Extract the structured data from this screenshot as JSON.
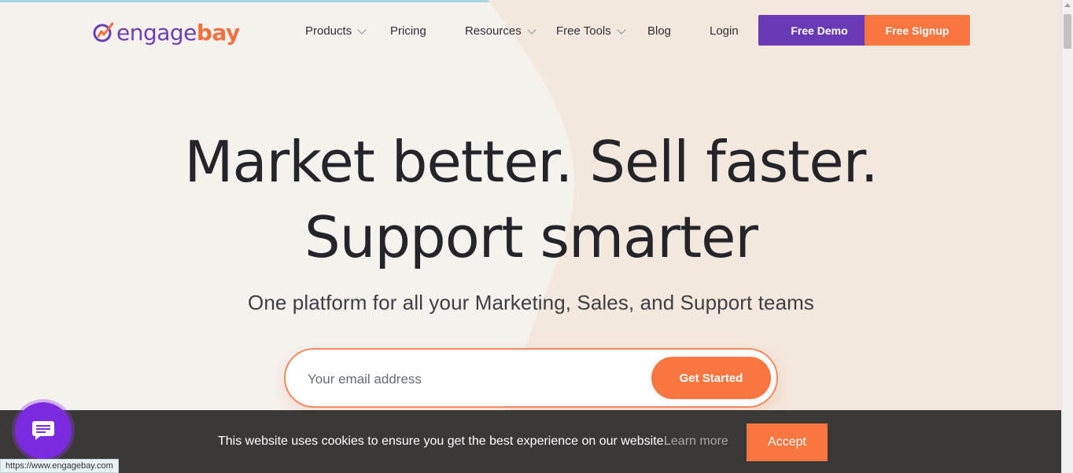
{
  "brand": {
    "name_part1": "engage",
    "name_part2": "bay",
    "purple": "#6a39b6",
    "orange": "#f97641"
  },
  "nav": {
    "items": [
      {
        "label": "Products",
        "has_dropdown": true
      },
      {
        "label": "Pricing",
        "has_dropdown": false
      },
      {
        "label": "Resources",
        "has_dropdown": true
      },
      {
        "label": "Free Tools",
        "has_dropdown": true
      },
      {
        "label": "Blog",
        "has_dropdown": false
      },
      {
        "label": "Login",
        "has_dropdown": false
      }
    ],
    "demo_label": "Free Demo",
    "signup_label": "Free Signup"
  },
  "hero": {
    "title_line1": "Market better. Sell faster.",
    "title_line2": "Support smarter",
    "subtitle": "One platform for all your Marketing, Sales, and Support teams",
    "email_placeholder": "Your email address",
    "cta_label": "Get Started"
  },
  "cookie": {
    "message": "This website uses cookies to ensure you get the best experience on our website.",
    "learn_more": "Learn more",
    "accept_label": "Accept"
  },
  "chat": {
    "icon": "chat-bubble-icon"
  },
  "status_bar": {
    "url": "https://www.engagebay.com"
  }
}
